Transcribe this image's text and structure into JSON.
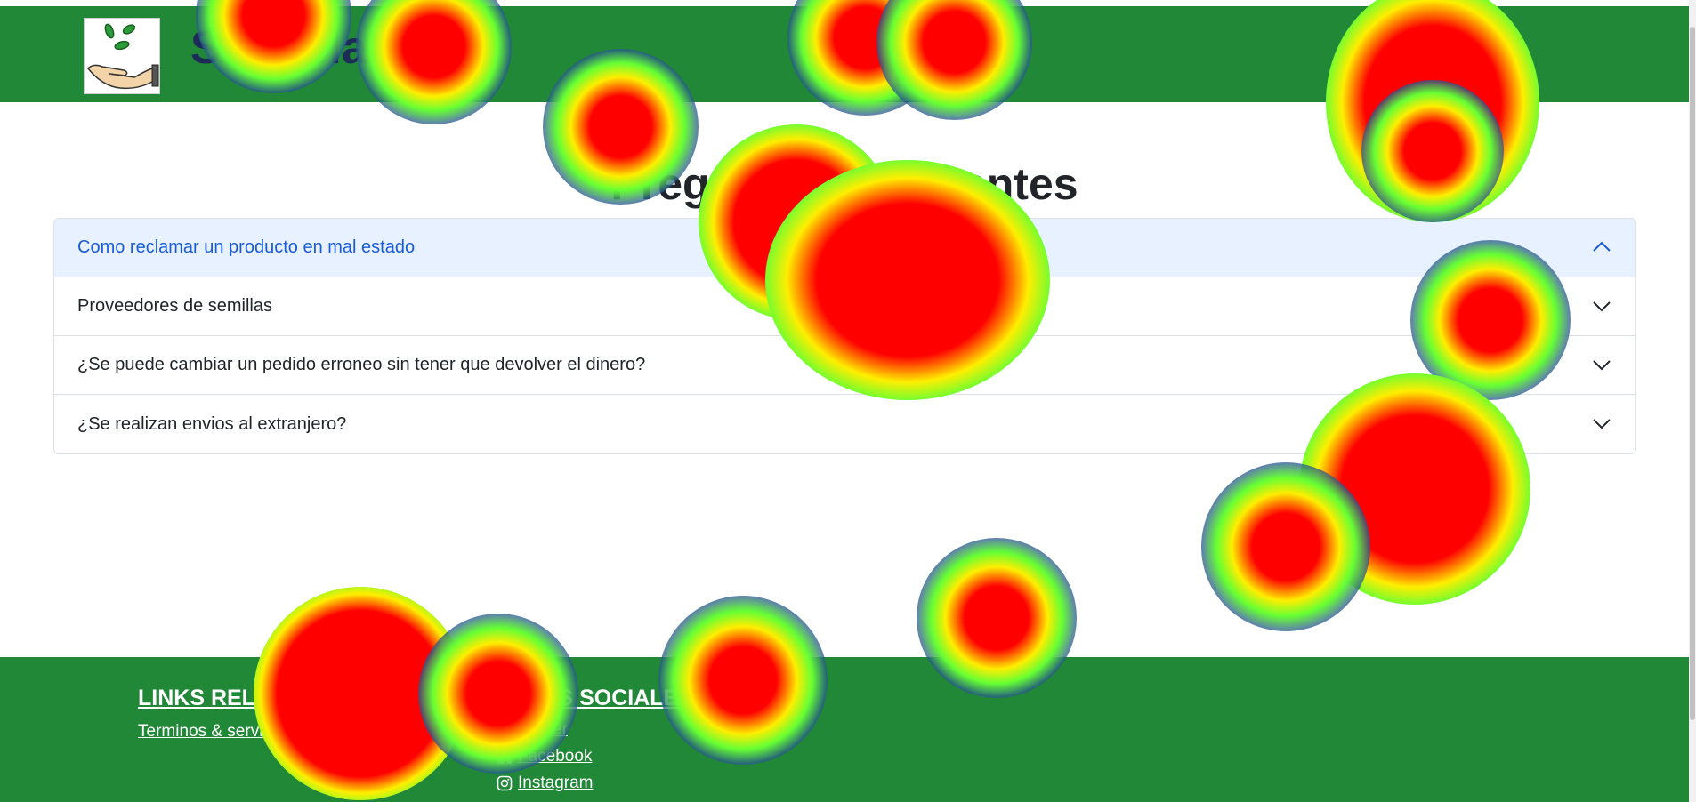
{
  "header": {
    "brand": "SeedMarke",
    "faint_text": "e"
  },
  "main": {
    "title": "Preguntas Frecuentes",
    "faq": [
      {
        "label": "Como reclamar un producto en mal estado",
        "expanded": true
      },
      {
        "label": "Proveedores de semillas",
        "expanded": false
      },
      {
        "label": "¿Se puede cambiar un pedido erroneo sin tener que devolver el dinero?",
        "expanded": false
      },
      {
        "label": "¿Se realizan envios al extranjero?",
        "expanded": false
      }
    ]
  },
  "footer": {
    "links_heading": "LINKS RELAC",
    "links": [
      "Terminos & servicio"
    ],
    "social_heading": "REDES SOCIALES",
    "social": [
      {
        "label": "Twitter",
        "icon": "twitter-icon"
      },
      {
        "label": "Facebook",
        "icon": "facebook-icon"
      },
      {
        "label": "Instagram",
        "icon": "instagram-icon"
      }
    ]
  },
  "colors": {
    "header_bg": "#218838",
    "footer_bg": "#218838",
    "active_item_bg": "#e7f1ff",
    "active_item_text": "#1a5cd8",
    "brand_text": "#1c2b57"
  }
}
